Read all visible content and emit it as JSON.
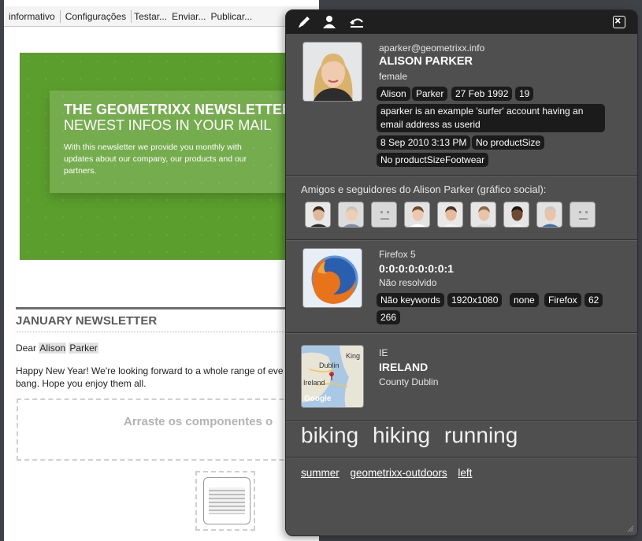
{
  "toolbar": {
    "items": [
      "informativo",
      "Configurações",
      "Testar...",
      "Enviar...",
      "Publicar..."
    ]
  },
  "newsletter": {
    "banner_title": "THE GEOMETRIXX NEWSLETTER",
    "banner_subtitle": "NEWEST INFOS IN YOUR MAIL",
    "banner_text": "With this newsletter we provide you monthly with updates about our company, our products and our partners.",
    "heading": "JANUARY NEWSLETTER",
    "dear": "Dear",
    "first_name": "Alison",
    "last_name": "Parker",
    "body_line1": "Happy New Year! We're looking forward to a whole range of eve",
    "body_line2": "bang. Hope you enjoy them all.",
    "drop_hint": "Arraste os componentes o"
  },
  "profile": {
    "email": "aparker@geometrixx.info",
    "name": "ALISON PARKER",
    "gender": "female",
    "first_name": "Alison",
    "last_name": "Parker",
    "birthday": "27 Feb 1992",
    "age": "19",
    "description": "aparker is an example 'surfer' account having an email address as userid",
    "last_login": "8 Sep 2010 3:13 PM",
    "product_size": "No productSize",
    "product_size_footwear": "No productSizeFootwear"
  },
  "social": {
    "title": "Amigos e seguidores do Alison Parker (gráfico social):",
    "friends": [
      {
        "type": "photo",
        "skin": "#e0b89a",
        "hair": "#3a2a1f",
        "shirt": "#2b2b2b",
        "bg": "#e9e9e9"
      },
      {
        "type": "photo",
        "skin": "#f0cdb4",
        "hair": "#c9c3b8",
        "shirt": "#7e8da6",
        "bg": "#dcdcdc"
      },
      {
        "type": "placeholder"
      },
      {
        "type": "photo",
        "skin": "#efc7ad",
        "hair": "#6b4a2f",
        "shirt": "#ffffff",
        "bg": "#e3e3e3"
      },
      {
        "type": "photo",
        "skin": "#e6bb9c",
        "hair": "#4a3322",
        "shirt": "#f3f3f3",
        "bg": "#e8e8e8"
      },
      {
        "type": "photo",
        "skin": "#e8c3a7",
        "hair": "#8a6a4a",
        "shirt": "#d9d9d9",
        "bg": "#e6e6e6"
      },
      {
        "type": "photo",
        "skin": "#6e4a33",
        "hair": "#1f1510",
        "shirt": "#f0f0f0",
        "bg": "#e5e5e5"
      },
      {
        "type": "photo",
        "skin": "#eac4a6",
        "hair": "#c7c7c7",
        "shirt": "#3c6ea8",
        "bg": "#e2e2e2"
      },
      {
        "type": "placeholder"
      }
    ]
  },
  "browser": {
    "name": "Firefox 5",
    "ip": "0:0:0:0:0:0:0:1",
    "resolved": "Não resolvido",
    "keywords": "Não keywords",
    "resolution": "1920x1080",
    "none": "none",
    "family": "Firefox",
    "v1": "62",
    "v2": "266"
  },
  "geo": {
    "code": "IE",
    "country": "IRELAND",
    "region": "County Dublin",
    "map_labels": [
      "Dublin",
      "King",
      "Ireland",
      "Google"
    ]
  },
  "tags": [
    "biking",
    "hiking",
    "running"
  ],
  "links": [
    "summer",
    "geometrixx-outdoors",
    "left"
  ],
  "colors": {
    "panel_bg": "#4e4f4e",
    "panel_toolbar": "#1f1f1f",
    "tag_bg": "#1b1b1b",
    "banner_green": "#5b9e2d"
  }
}
